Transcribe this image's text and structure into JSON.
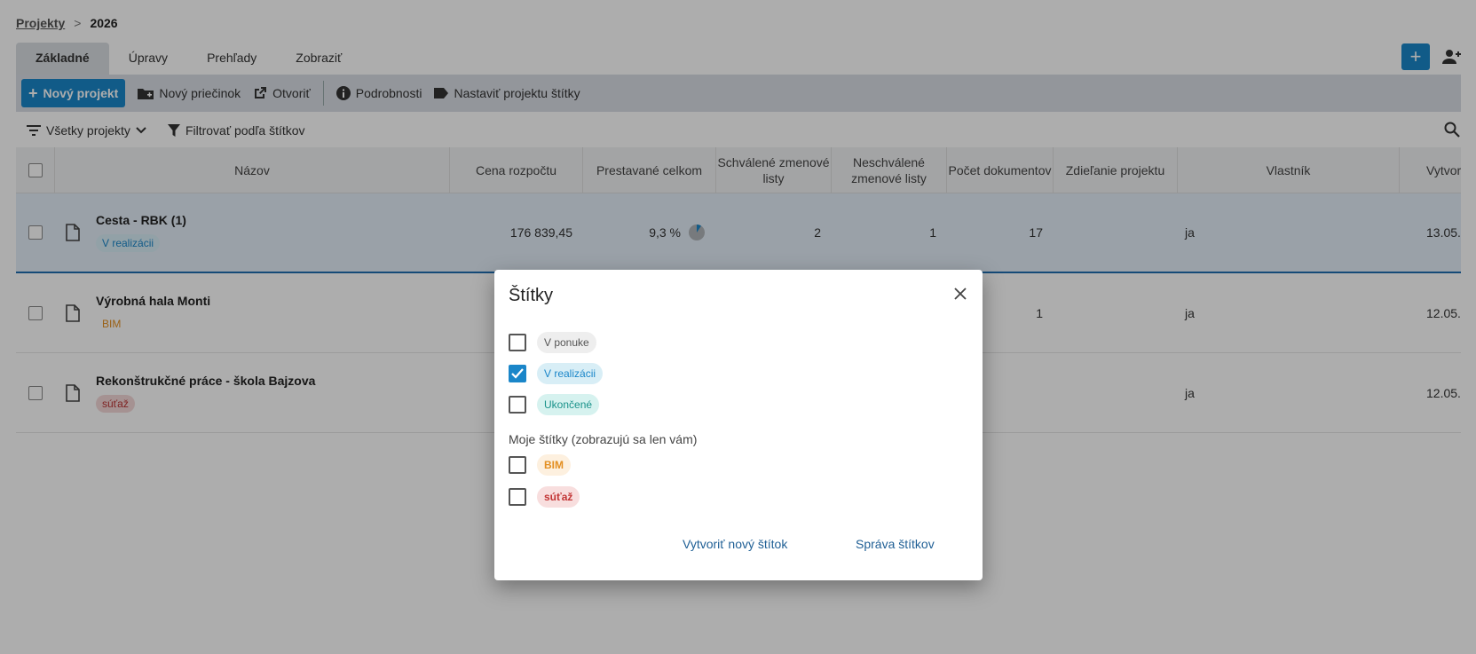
{
  "breadcrumb": {
    "parent": "Projekty",
    "separator": ">",
    "current": "2026"
  },
  "tabs": [
    {
      "label": "Základné"
    },
    {
      "label": "Úpravy"
    },
    {
      "label": "Prehľady"
    },
    {
      "label": "Zobraziť"
    }
  ],
  "toolbar": {
    "new_project": "Nový projekt",
    "new_folder": "Nový priečinok",
    "open": "Otvoriť",
    "details": "Podrobnosti",
    "set_tags": "Nastaviť projektu štítky"
  },
  "filters": {
    "all_projects": "Všetky projekty",
    "filter_by_tags": "Filtrovať podľa štítkov"
  },
  "table": {
    "headers": [
      "Názov",
      "Cena rozpočtu",
      "Prestavané celkom",
      "Schválené zmenové listy",
      "Neschválené zmenové listy",
      "Počet dokumentov",
      "Zdieľanie projektu",
      "Vlastník",
      "Vytvor"
    ],
    "rows": [
      {
        "name": "Cesta - RBK (1)",
        "tag": "V realizácii",
        "budget": "176 839,45",
        "built": "9,3 %",
        "approved": "2",
        "unapproved": "1",
        "docs": "17",
        "owner": "ja",
        "created": "13.05."
      },
      {
        "name": "Výrobná hala Monti",
        "tag": "BIM",
        "budget": "",
        "built": "",
        "approved": "",
        "unapproved": "",
        "docs": "1",
        "owner": "ja",
        "created": "12.05."
      },
      {
        "name": "Rekonštrukčné práce - škola Bajzova",
        "tag": "súťaž",
        "budget": "",
        "built": "",
        "approved": "",
        "unapproved": "",
        "docs": "",
        "owner": "ja",
        "created": "12.05."
      }
    ]
  },
  "dialog": {
    "title": "Štítky",
    "tags": [
      {
        "label": "V ponuke",
        "checked": false
      },
      {
        "label": "V realizácii",
        "checked": true
      },
      {
        "label": "Ukončené",
        "checked": false
      }
    ],
    "my_tags_label": "Moje štítky (zobrazujú sa len vám)",
    "my_tags": [
      {
        "label": "BIM",
        "checked": false
      },
      {
        "label": "súťaž",
        "checked": false
      }
    ],
    "create_button": "Vytvoriť nový štítok",
    "manage_button": "Správa štítkov"
  },
  "colors": {
    "accent": "#1a86c9",
    "link": "#1f5f95"
  }
}
